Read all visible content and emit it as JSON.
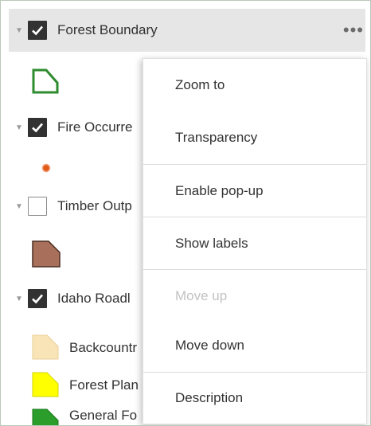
{
  "layers": [
    {
      "title": "Forest Boundary",
      "checked": true,
      "selected": true
    },
    {
      "title": "Fire Occurre",
      "checked": true
    },
    {
      "title": "Timber Outp",
      "checked": false
    },
    {
      "title": "Idaho Roadl",
      "checked": true
    }
  ],
  "legend": {
    "boundary_icon": "polygon-outline-green",
    "fire_icon": "orange-point",
    "timber_icon": "brown-polygon",
    "roadless_items": [
      {
        "label": "Backcountr",
        "color": "#f9e4b7"
      },
      {
        "label": "Forest Plan",
        "color": "#ffff00"
      },
      {
        "label": "General Fo",
        "color": "#2a9d2a"
      }
    ]
  },
  "more_icon": "ellipsis-icon",
  "menu": {
    "items": [
      {
        "label": "Zoom to",
        "disabled": false
      },
      {
        "label": "Transparency",
        "disabled": false
      },
      {
        "label": "Enable pop-up",
        "disabled": false
      },
      {
        "label": "Show labels",
        "disabled": false
      },
      {
        "label": "Move up",
        "disabled": true
      },
      {
        "label": "Move down",
        "disabled": false
      },
      {
        "label": "Description",
        "disabled": false
      }
    ]
  }
}
